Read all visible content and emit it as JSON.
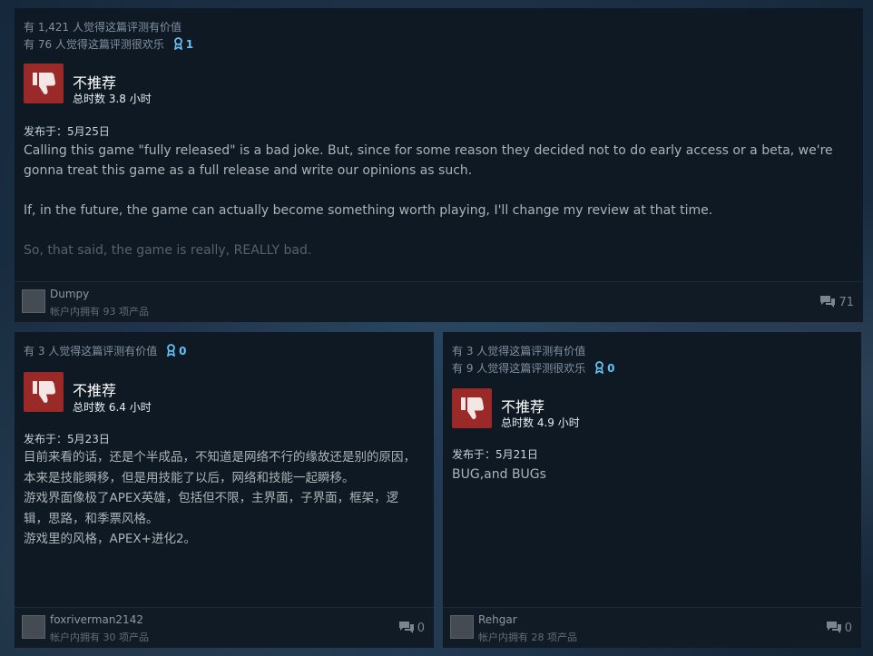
{
  "reviews": [
    {
      "helpful_line": "有 1,421 人觉得这篇评测有价值",
      "funny_line": "有 76 人觉得这篇评测很欢乐",
      "award_count": "1",
      "verdict": "不推荐",
      "hours": "总时数 3.8 小时",
      "posted": "发布于：5月25日",
      "paragraphs": [
        "Calling this game \"fully released\" is a bad joke. But, since for some reason they decided not to do early access or a beta, we're gonna treat this game as a full release and write our opinions as such.",
        "If, in the future, the game can actually become something worth playing, I'll change my review at that time.",
        "So, that said, the game is really, REALLY bad."
      ],
      "username": "Dumpy",
      "products": "帐户内拥有 93 项产品",
      "comments": "71"
    },
    {
      "helpful_line": "有 3 人觉得这篇评测有价值",
      "award_count": "0",
      "verdict": "不推荐",
      "hours": "总时数 6.4 小时",
      "posted": "发布于：5月23日",
      "paragraphs": [
        "目前来看的话，还是个半成品，不知道是网络不行的缘故还是别的原因，本来是技能瞬移，但是用技能了以后，网络和技能一起瞬移。",
        "游戏界面像极了APEX英雄，包括但不限，主界面，子界面，框架，逻辑，思路，和季票风格。",
        "游戏里的风格，APEX+进化2。"
      ],
      "username": "foxriverman2142",
      "products": "帐户内拥有 30 项产品",
      "comments": "0"
    },
    {
      "helpful_line": "有 3 人觉得这篇评测有价值",
      "funny_line": "有 9 人觉得这篇评测很欢乐",
      "award_count": "0",
      "verdict": "不推荐",
      "hours": "总时数 4.9 小时",
      "posted": "发布于：5月21日",
      "paragraphs": [
        "BUG,and BUGs"
      ],
      "username": "Rehgar",
      "products": "帐户内拥有 28 项产品",
      "comments": "0"
    }
  ],
  "colors": {
    "thumb_bg": "#9a2a28",
    "award": "#66c0f4",
    "card_bg": "#0f1923"
  },
  "icons": {
    "verdict": "thumbs-down-icon",
    "award": "award-ribbon-icon",
    "comments": "comment-bubble-icon"
  }
}
